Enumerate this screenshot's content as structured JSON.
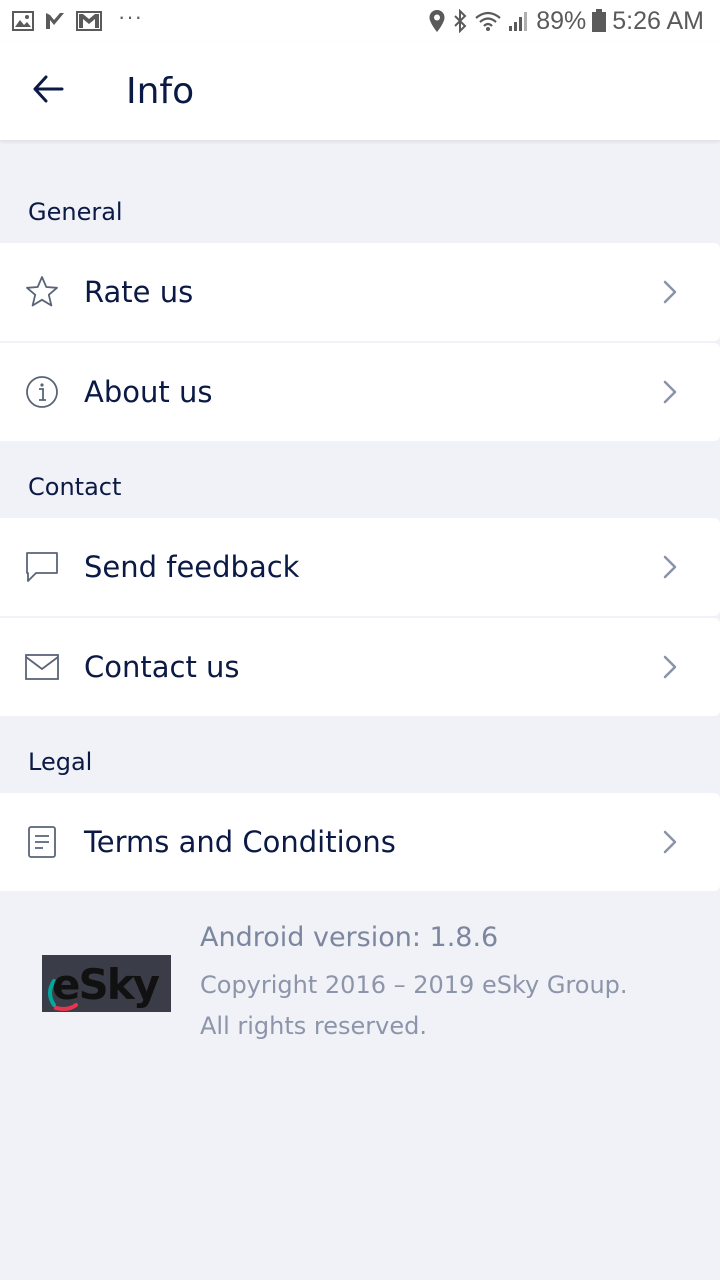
{
  "status_bar": {
    "battery": "89%",
    "time": "5:26 AM",
    "overflow": "···"
  },
  "header": {
    "title": "Info"
  },
  "sections": [
    {
      "label": "General",
      "items": [
        {
          "label": "Rate us",
          "icon": "star-icon"
        },
        {
          "label": "About us",
          "icon": "info-icon"
        }
      ]
    },
    {
      "label": "Contact",
      "items": [
        {
          "label": "Send feedback",
          "icon": "chat-icon"
        },
        {
          "label": "Contact us",
          "icon": "mail-icon"
        }
      ]
    },
    {
      "label": "Legal",
      "items": [
        {
          "label": "Terms and Conditions",
          "icon": "document-icon"
        }
      ]
    }
  ],
  "footer": {
    "logo_text": "eSky",
    "version": "Android version: 1.8.6",
    "copyright_line1": "Copyright 2016 – 2019 eSky Group.",
    "copyright_line2": "All rights reserved."
  },
  "colors": {
    "text_primary": "#0b1a45",
    "text_muted": "#7c869e",
    "background": "#f1f2f7",
    "surface": "#ffffff",
    "icon_gray": "#5a6478"
  }
}
